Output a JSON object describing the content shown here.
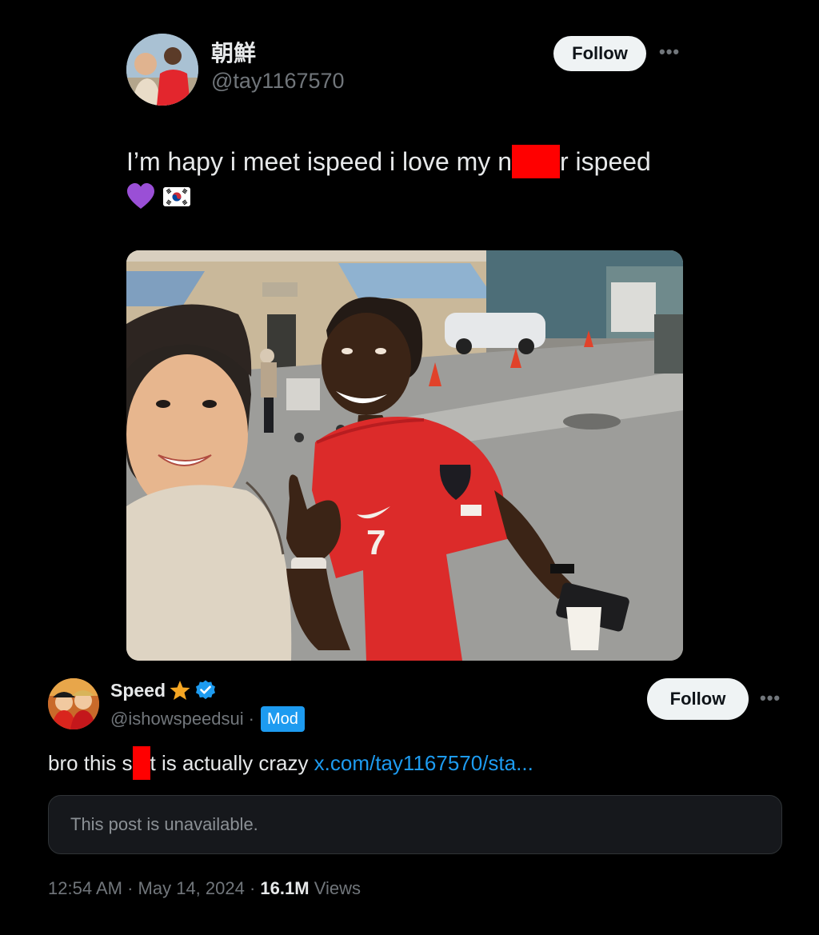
{
  "quoted_post": {
    "author_name": "朝鮮",
    "author_handle": "@tay1167570",
    "follow_label": "Follow",
    "more_label": "•••",
    "text_before_redaction": "I’m hapy i meet ispeed i love my n",
    "text_after_redaction": "r ispeed",
    "emojis": [
      "purple-heart-icon",
      "south-korea-flag-icon"
    ],
    "photo_icon": "selfie-photo"
  },
  "main_post": {
    "author_name": "Speed",
    "author_handle": "@ishowspeedsui",
    "separator": "·",
    "mod_badge": "Mod",
    "follow_label": "Follow",
    "more_label": "•••",
    "text_before_redaction": "bro this s",
    "text_after_redaction": "t is actually crazy ",
    "link_text": "x.com/tay1167570/sta...",
    "unavailable_text": "This post is unavailable.",
    "time": "12:54 AM",
    "date": "May 14, 2024",
    "views_count": "16.1M",
    "views_label": " Views"
  },
  "colors": {
    "background": "#000000",
    "text": "#e7e9ea",
    "muted": "#71767b",
    "link": "#1d9bf0",
    "redaction": "#ff0000",
    "star": "#f5a623",
    "verified": "#1d9bf0"
  }
}
